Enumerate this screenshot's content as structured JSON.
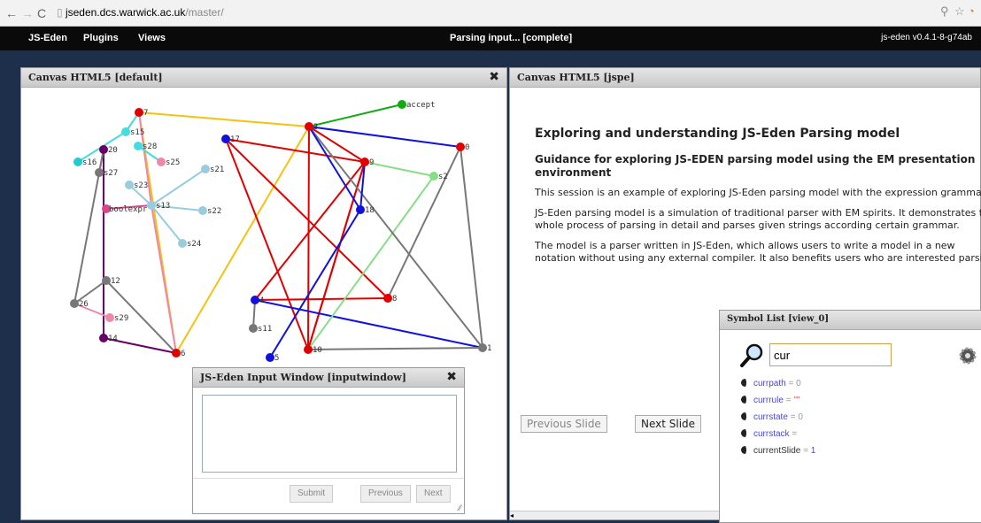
{
  "browser": {
    "url_host": "jseden.dcs.warwick.ac.uk",
    "url_path": "/master/"
  },
  "appbar": {
    "menu": [
      "JS-Eden",
      "Plugins",
      "Views"
    ],
    "status": "Parsing input... [complete]",
    "version": "js-eden v0.4.1-8-g74ab"
  },
  "canvas_default": {
    "title": "Canvas HTML5 [default]",
    "nodes": [
      {
        "label": "7"
      },
      {
        "label": "s15"
      },
      {
        "label": "20"
      },
      {
        "label": "s16"
      },
      {
        "label": "s27"
      },
      {
        "label": "s28"
      },
      {
        "label": "s25"
      },
      {
        "label": "s23"
      },
      {
        "label": "s21"
      },
      {
        "label": "boolexpr"
      },
      {
        "label": "s13"
      },
      {
        "label": "s22"
      },
      {
        "label": "s24"
      },
      {
        "label": "12"
      },
      {
        "label": "26"
      },
      {
        "label": "s29"
      },
      {
        "label": "14"
      },
      {
        "label": "6"
      },
      {
        "label": "17"
      },
      {
        "label": "3"
      },
      {
        "label": "accept"
      },
      {
        "label": "0"
      },
      {
        "label": "9"
      },
      {
        "label": "s2"
      },
      {
        "label": "18"
      },
      {
        "label": "4"
      },
      {
        "label": "8"
      },
      {
        "label": "s11"
      },
      {
        "label": "10"
      },
      {
        "label": "5"
      },
      {
        "label": "1"
      }
    ]
  },
  "canvas_jspe": {
    "title": "Canvas HTML5 [jspe]",
    "heading": "Exploring and understanding JS-Eden Parsing model",
    "subheading": "Guidance for exploring JS-EDEN parsing model using the EM presentation environment",
    "paragraphs": [
      "This session is an example of exploring JS-Eden parsing model with the expression grammar.",
      "JS-Eden parsing model is a simulation of traditional parser with EM spirits. It demonstrates the whole process of parsing in detail and parses given strings according certain grammar.",
      "The model is a parser written in JS-Eden, which allows users to write a model in a new notation without using any external compiler. It also benefits users who are interested parsing theory, making them understand the process of parsing during their exploring"
    ],
    "prev_label": "Previous Slide",
    "next_label": "Next Slide"
  },
  "input_window": {
    "title": "JS-Eden Input Window [inputwindow]",
    "submit_label": "Submit",
    "previous_label": "Previous",
    "next_label": "Next"
  },
  "symbol_list": {
    "title": "Symbol List [view_0]",
    "search_value": "cur",
    "symbols": [
      {
        "name": "currpath",
        "eq": " = ",
        "value": "0"
      },
      {
        "name": "currrule",
        "eq": " = ",
        "value": "\"\""
      },
      {
        "name": "currstate",
        "eq": " = ",
        "value": "0"
      },
      {
        "name": "currstack",
        "eq": " =",
        "value": ""
      },
      {
        "name": "currentSlide",
        "eq": " = ",
        "value": "1"
      }
    ]
  },
  "icons": {
    "search": "magnifier-icon",
    "settings": "gear-icon",
    "close": "close-icon",
    "symbol": "symbol-moon-icon"
  }
}
